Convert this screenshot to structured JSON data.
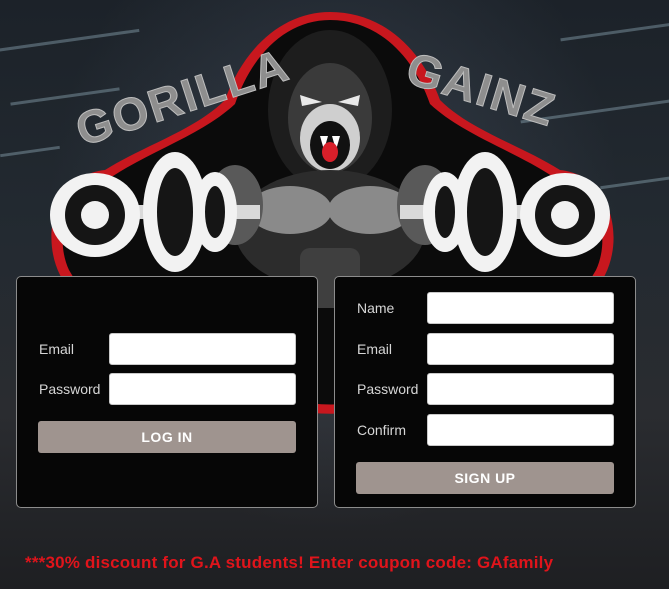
{
  "brand": {
    "word_left": "GORILLA",
    "word_right": "GAINZ",
    "logo_icon": "gorilla-dumbbell-icon",
    "colors": {
      "outline": "#c8171e",
      "text": "#8e8e8e"
    }
  },
  "login": {
    "email_label": "Email",
    "password_label": "Password",
    "email_value": "",
    "password_value": "",
    "submit_label": "LOG IN"
  },
  "signup": {
    "name_label": "Name",
    "email_label": "Email",
    "password_label": "Password",
    "confirm_label": "Confirm",
    "submit_label": "SIGN UP"
  },
  "promo_text": "***30% discount for G.A students! Enter coupon code: GAfamily",
  "colors": {
    "button": "#9f948f",
    "promo": "#e0141b",
    "panel": "#060606"
  }
}
